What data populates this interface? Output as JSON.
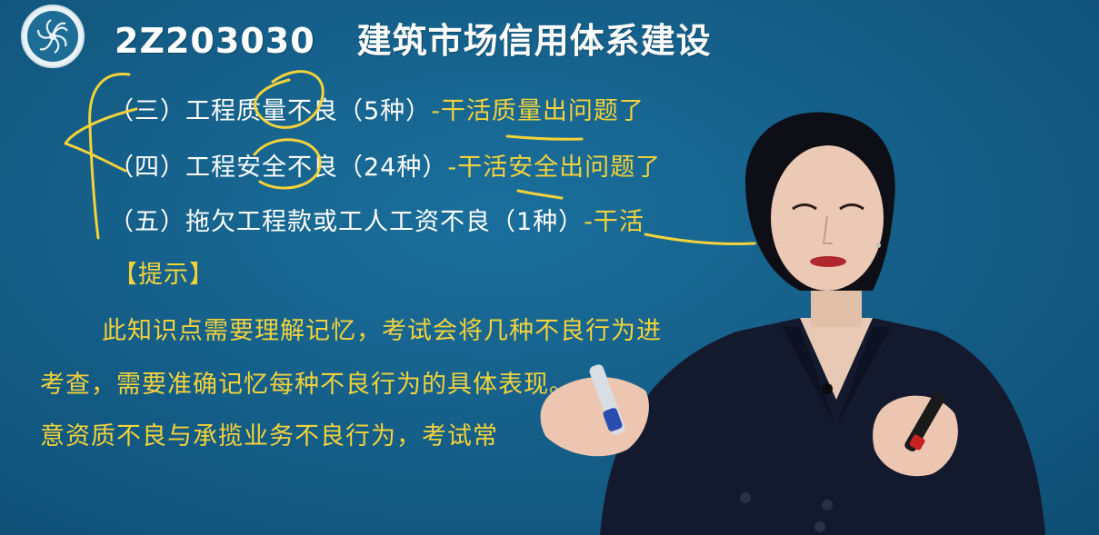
{
  "header": {
    "code": "2Z203030",
    "title": "建筑市场信用体系建设"
  },
  "items": [
    {
      "prefix": "（三）工程质量不良（5种）",
      "suffix": "-干活质量出问题了"
    },
    {
      "prefix": "（四）工程安全不良（24种）",
      "suffix": "-干活安全出问题了"
    },
    {
      "prefix": "（五）拖欠工程款或工人工资不良（1种）",
      "suffix": "-干活"
    }
  ],
  "hint": {
    "label": "【提示】",
    "lines": [
      "此知识点需要理解记忆，考试会将几种不良行为进",
      "考查，需要准确记忆每种不良行为的具体表现。",
      "意资质不良与承揽业务不良行为，考试常"
    ]
  },
  "colors": {
    "background": "#15608a",
    "accent_yellow": "#f3d23a",
    "text_white": "#ffffff"
  },
  "icons": {
    "logo": "spiral-flower-logo-icon"
  }
}
